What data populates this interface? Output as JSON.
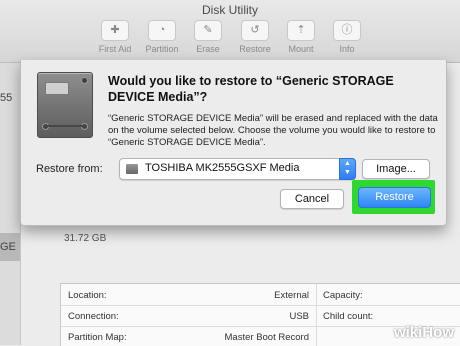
{
  "window": {
    "title": "Disk Utility"
  },
  "toolbar": [
    {
      "label": "First Aid",
      "icon": "stethoscope-icon",
      "glyph": "✚"
    },
    {
      "label": "Partition",
      "icon": "partition-icon",
      "glyph": "◔"
    },
    {
      "label": "Erase",
      "icon": "erase-icon",
      "glyph": "✎"
    },
    {
      "label": "Restore",
      "icon": "restore-icon",
      "glyph": "↺"
    },
    {
      "label": "Mount",
      "icon": "mount-icon",
      "glyph": "⇡"
    },
    {
      "label": "Info",
      "icon": "info-icon",
      "glyph": "ⓘ"
    }
  ],
  "sidebar": {
    "partial_text_1": "55",
    "partial_text_2": "GE"
  },
  "volume": {
    "size": "31.72 GB"
  },
  "info_table": {
    "rows": [
      {
        "label": "Location:",
        "value": "External",
        "label2": "Capacity:"
      },
      {
        "label": "Connection:",
        "value": "USB",
        "label2": "Child count:"
      },
      {
        "label": "Partition Map:",
        "value": "Master Boot Record",
        "label2": ""
      }
    ]
  },
  "dialog": {
    "heading": "Would you like to restore to “Generic STORAGE DEVICE Media”?",
    "body": "“Generic STORAGE DEVICE Media” will be erased and replaced with the data on the volume selected below. Choose the volume you would like to restore to “Generic STORAGE DEVICE Media”.",
    "restore_from_label": "Restore from:",
    "restore_from_value": "TOSHIBA MK2555GSXF Media",
    "image_button": "Image...",
    "cancel_button": "Cancel",
    "restore_button": "Restore",
    "highlight_color": "#2fd82f"
  },
  "watermark": {
    "prefix": "wiki",
    "suffix": "How"
  }
}
